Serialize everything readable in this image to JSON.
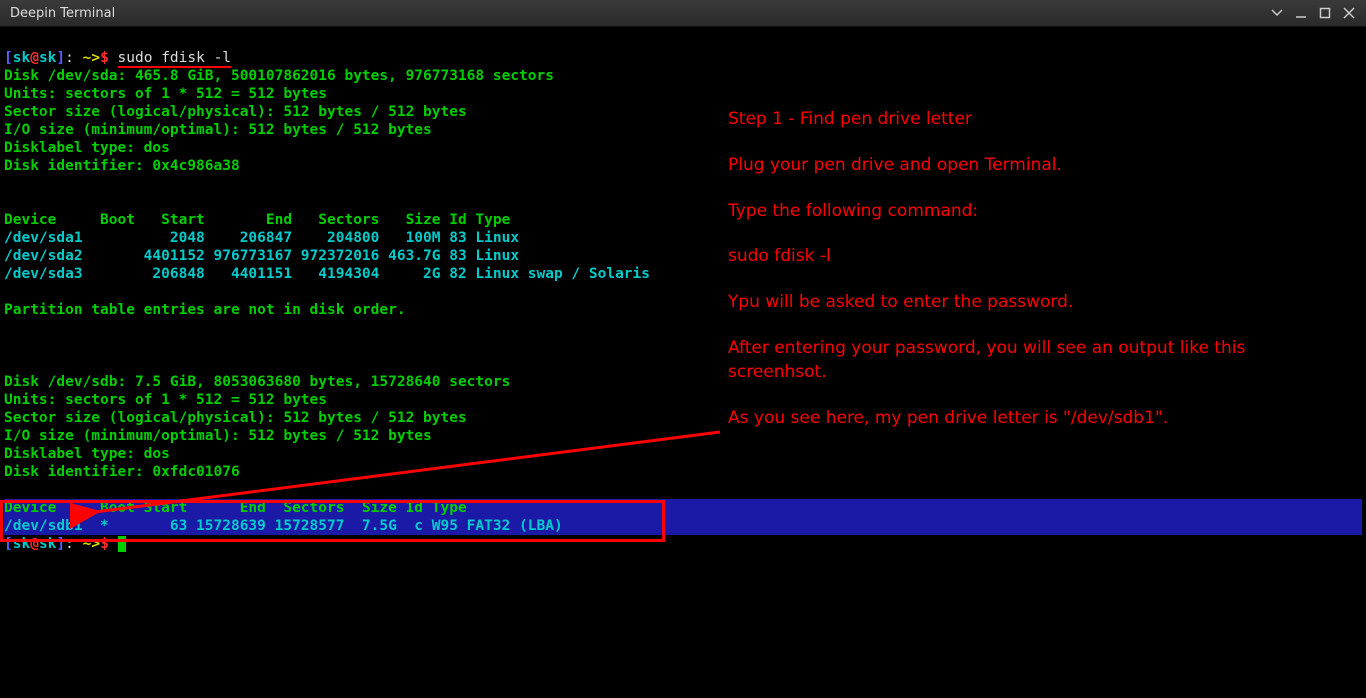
{
  "window": {
    "title": "Deepin Terminal"
  },
  "prompt": {
    "open_bracket": "[",
    "user": "sk",
    "at": "@",
    "host": "sk",
    "close_bracket": "]",
    "path_sep": ": ",
    "path": "~>",
    "dollar": "$ ",
    "command": "sudo fdisk -l"
  },
  "disk_sda": {
    "header": "Disk /dev/sda: 465.8 GiB, 500107862016 bytes, 976773168 sectors",
    "units": "Units: sectors of 1 * 512 = 512 bytes",
    "sector": "Sector size (logical/physical): 512 bytes / 512 bytes",
    "io": "I/O size (minimum/optimal): 512 bytes / 512 bytes",
    "labeltype": "Disklabel type: dos",
    "identifier": "Disk identifier: 0x4c986a38"
  },
  "table_sda_header": "Device     Boot   Start       End   Sectors   Size Id Type",
  "table_sda_rows": {
    "r1": "/dev/sda1          2048    206847    204800   100M 83 Linux",
    "r2": "/dev/sda2       4401152 976773167 972372016 463.7G 83 Linux",
    "r3": "/dev/sda3        206848   4401151   4194304     2G 82 Linux swap / Solaris"
  },
  "partition_warning": "Partition table entries are not in disk order.",
  "disk_sdb": {
    "header": "Disk /dev/sdb: 7.5 GiB, 8053063680 bytes, 15728640 sectors",
    "units": "Units: sectors of 1 * 512 = 512 bytes",
    "sector": "Sector size (logical/physical): 512 bytes / 512 bytes",
    "io": "I/O size (minimum/optimal): 512 bytes / 512 bytes",
    "labeltype": "Disklabel type: dos",
    "identifier": "Disk identifier: 0xfdc01076"
  },
  "table_sdb_header": "Device     Boot Start      End  Sectors  Size Id Type",
  "table_sdb_row": "/dev/sdb1  *       63 15728639 15728577  7.5G  c W95 FAT32 (LBA)",
  "annotation": {
    "step": "Step 1 - Find pen drive letter",
    "p1": "Plug your pen drive and open Terminal.",
    "p2": "Type the following command:",
    "cmd": "sudo fdisk -l",
    "p3": "Ypu will be asked to enter the password.",
    "p4": "After entering your password, you will see an output like this screenhsot.",
    "p5": "As you see here, my pen drive letter is \"/dev/sdb1\"."
  }
}
